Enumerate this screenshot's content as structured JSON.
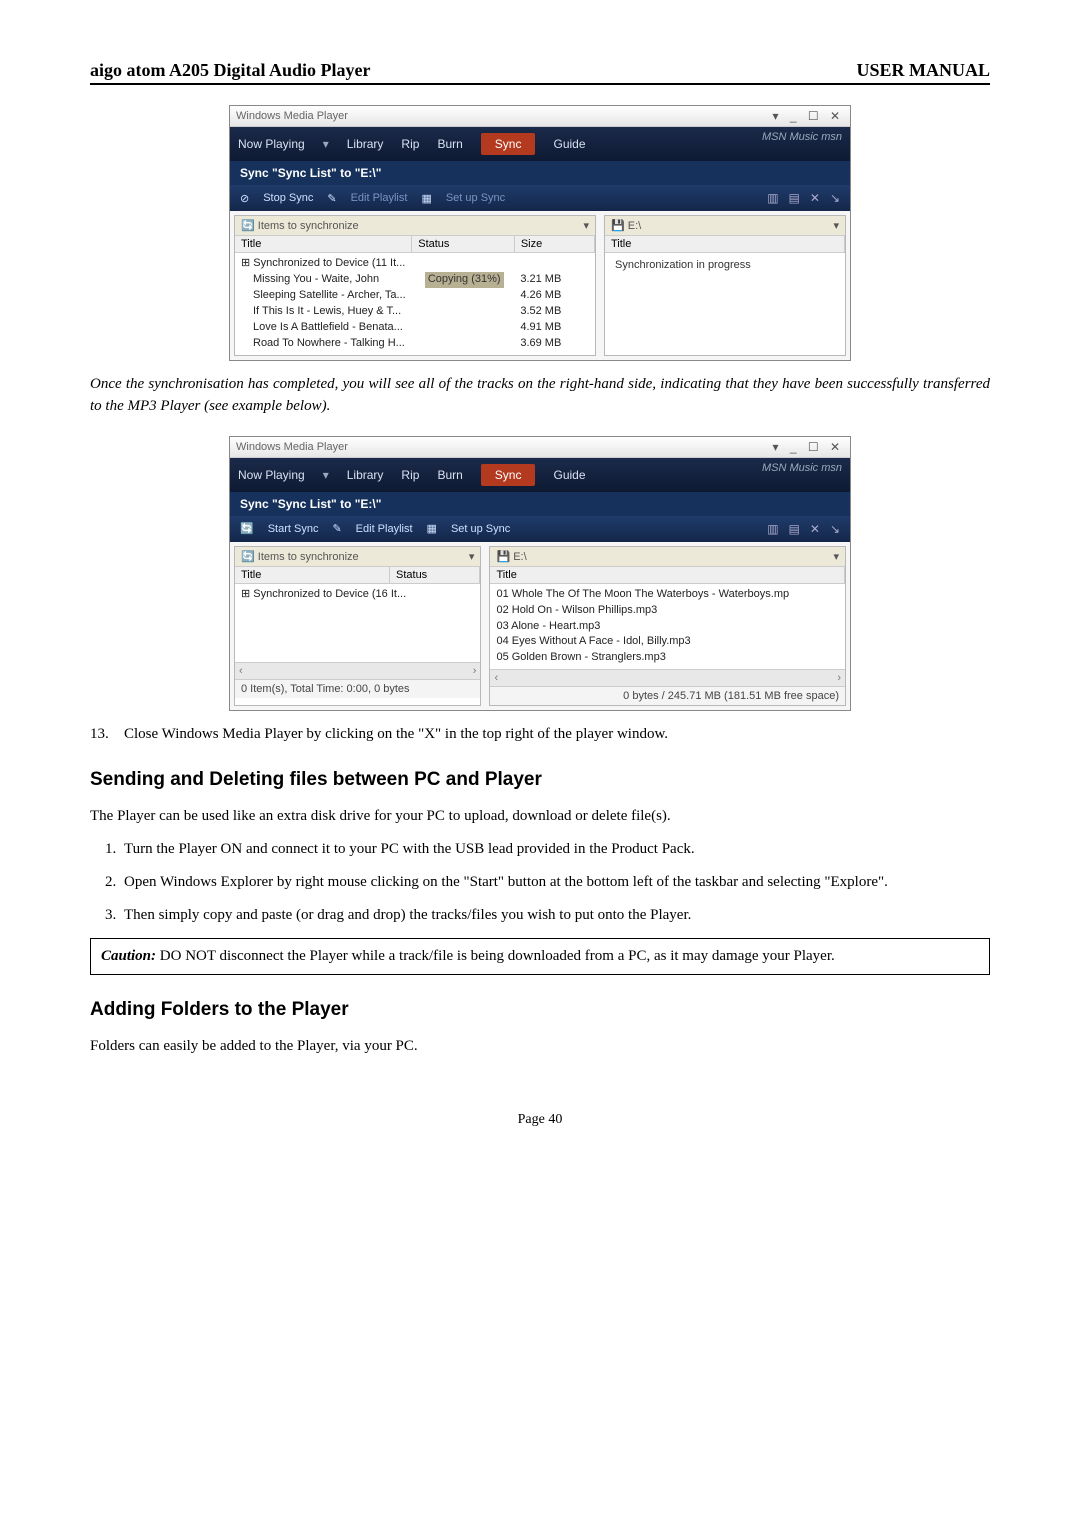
{
  "header": {
    "left": "aigo atom A205 Digital Audio Player",
    "right": "USER MANUAL"
  },
  "wmp_window_title": "Windows Media Player",
  "win_buttons": "▾  _  ☐  ✕",
  "tabs": {
    "now_playing": "Now Playing",
    "library": "Library",
    "rip": "Rip",
    "burn": "Burn",
    "sync": "Sync",
    "guide": "Guide",
    "msn": "MSN Music   msn"
  },
  "sync_header": "Sync \"Sync List\" to \"E:\\\"",
  "toolbar1": {
    "stop": "Stop Sync",
    "edit": "Edit Playlist",
    "setup": "Set up Sync"
  },
  "toolbar2": {
    "start": "Start Sync",
    "edit": "Edit Playlist",
    "setup": "Set up Sync"
  },
  "pane_left_head": "Items to synchronize",
  "pane_right_head": "E:\\",
  "cols": {
    "title": "Title",
    "status": "Status",
    "size": "Size"
  },
  "sync1": {
    "header_row": "Synchronized to Device (11 It...",
    "rows": [
      {
        "title": "Missing You - Waite, John",
        "status": "Copying (31%)",
        "size": "3.21 MB"
      },
      {
        "title": "Sleeping Satellite - Archer, Ta...",
        "status": "",
        "size": "4.26 MB"
      },
      {
        "title": "If This Is It - Lewis, Huey & T...",
        "status": "",
        "size": "3.52 MB"
      },
      {
        "title": "Love Is A Battlefield - Benata...",
        "status": "",
        "size": "4.91 MB"
      },
      {
        "title": "Road To Nowhere - Talking H...",
        "status": "",
        "size": "3.69 MB"
      }
    ],
    "right_status": "Synchronization in progress"
  },
  "para_mid": "Once the synchronisation has completed, you will see all of the tracks on the right-hand side, indicating that they have been successfully transferred to the MP3 Player (see example below).",
  "sync2": {
    "header_row": "Synchronized to Device (16 It...",
    "device_files": [
      "01 Whole The Of The Moon The Waterboys - Waterboys.mp",
      "02 Hold On - Wilson Phillips.mp3",
      "03 Alone - Heart.mp3",
      "04 Eyes Without A Face - Idol, Billy.mp3",
      "05 Golden Brown - Stranglers.mp3"
    ],
    "status_left": "0 Item(s), Total Time: 0:00, 0 bytes",
    "status_right": "0 bytes / 245.71 MB (181.51 MB free space)"
  },
  "step13_num": "13.",
  "step13": "Close Windows Media Player by clicking on the \"X\" in the top right of the player window.",
  "section1": "Sending and Deleting files between PC and Player",
  "section1_intro": "The Player can be used like an extra disk drive for your PC to upload, download or delete file(s).",
  "section1_steps": [
    "Turn the Player ON and connect it to your PC with the USB lead provided in the Product Pack.",
    "Open Windows Explorer by right mouse clicking on the \"Start\" button at the bottom left of the taskbar and selecting \"Explore\".",
    "Then simply copy and paste (or drag and drop) the tracks/files you wish to put onto the Player."
  ],
  "caution_label": "Caution:",
  "caution_text": "  DO NOT disconnect the Player while a track/file is being downloaded from a PC, as it may damage your Player.",
  "section2": "Adding Folders to the Player",
  "section2_intro": "Folders can easily be added to the Player, via your PC.",
  "footer": "Page 40"
}
